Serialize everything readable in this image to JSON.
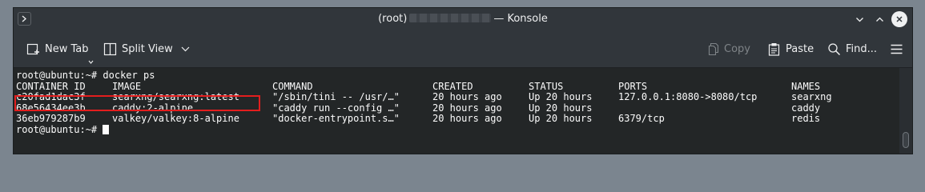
{
  "window": {
    "title_prefix": "(root)",
    "title_suffix": "— Konsole"
  },
  "toolbar": {
    "new_tab_label": "New Tab",
    "split_view_label": "Split View",
    "copy_label": "Copy",
    "paste_label": "Paste",
    "find_label": "Find..."
  },
  "terminal": {
    "prompt": "root@ubuntu:~#",
    "command": "docker ps",
    "headers": [
      "CONTAINER ID",
      "IMAGE",
      "COMMAND",
      "CREATED",
      "STATUS",
      "PORTS",
      "NAMES"
    ],
    "rows": [
      [
        "c20fad1dac3f",
        "searxng/searxng:latest",
        "\"/sbin/tini -- /usr/…\"",
        "20 hours ago",
        "Up 20 hours",
        "127.0.0.1:8080->8080/tcp",
        "searxng"
      ],
      [
        "68e56434ee3b",
        "caddy:2-alpine",
        "\"caddy run --config …\"",
        "20 hours ago",
        "Up 20 hours",
        "",
        "caddy"
      ],
      [
        "36eb979287b9",
        "valkey/valkey:8-alpine",
        "\"docker-entrypoint.s…\"",
        "20 hours ago",
        "Up 20 hours",
        "6379/tcp",
        "redis"
      ]
    ],
    "highlighted_row": 0
  },
  "colors": {
    "highlight": "#e31e1e",
    "terminal_bg": "#232627",
    "terminal_fg": "#fcfcfc"
  },
  "icons": [
    "terminal-menu-icon",
    "new-tab-icon",
    "split-view-icon",
    "copy-icon",
    "paste-icon",
    "search-icon",
    "hamburger-menu-icon",
    "chevron-down-icon",
    "minimize-icon",
    "maximize-icon",
    "close-icon"
  ]
}
